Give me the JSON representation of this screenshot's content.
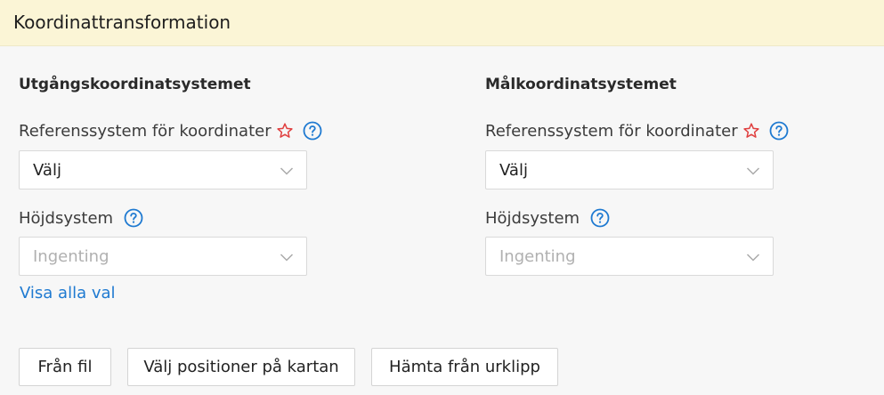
{
  "header": {
    "title": "Koordinattransformation"
  },
  "source": {
    "section_title": "Utgångskoordinatsystemet",
    "ref_label": "Referenssystem för koordinater",
    "ref_value": "Välj",
    "height_label": "Höjdsystem",
    "height_placeholder": "Ingenting",
    "show_all_link": "Visa alla val"
  },
  "target": {
    "section_title": "Målkoordinatsystemet",
    "ref_label": "Referenssystem för koordinater",
    "ref_value": "Välj",
    "height_label": "Höjdsystem",
    "height_placeholder": "Ingenting"
  },
  "buttons": {
    "from_file": "Från fil",
    "pick_on_map": "Välj positioner på kartan",
    "from_clipboard": "Hämta från urklipp"
  },
  "icons": {
    "required": "star-outline-icon",
    "help": "question-circle-icon",
    "dropdown": "chevron-down-icon"
  },
  "colors": {
    "header_bg": "#fbf5d6",
    "accent": "#1f7ad1",
    "required_star": "#e04040"
  }
}
